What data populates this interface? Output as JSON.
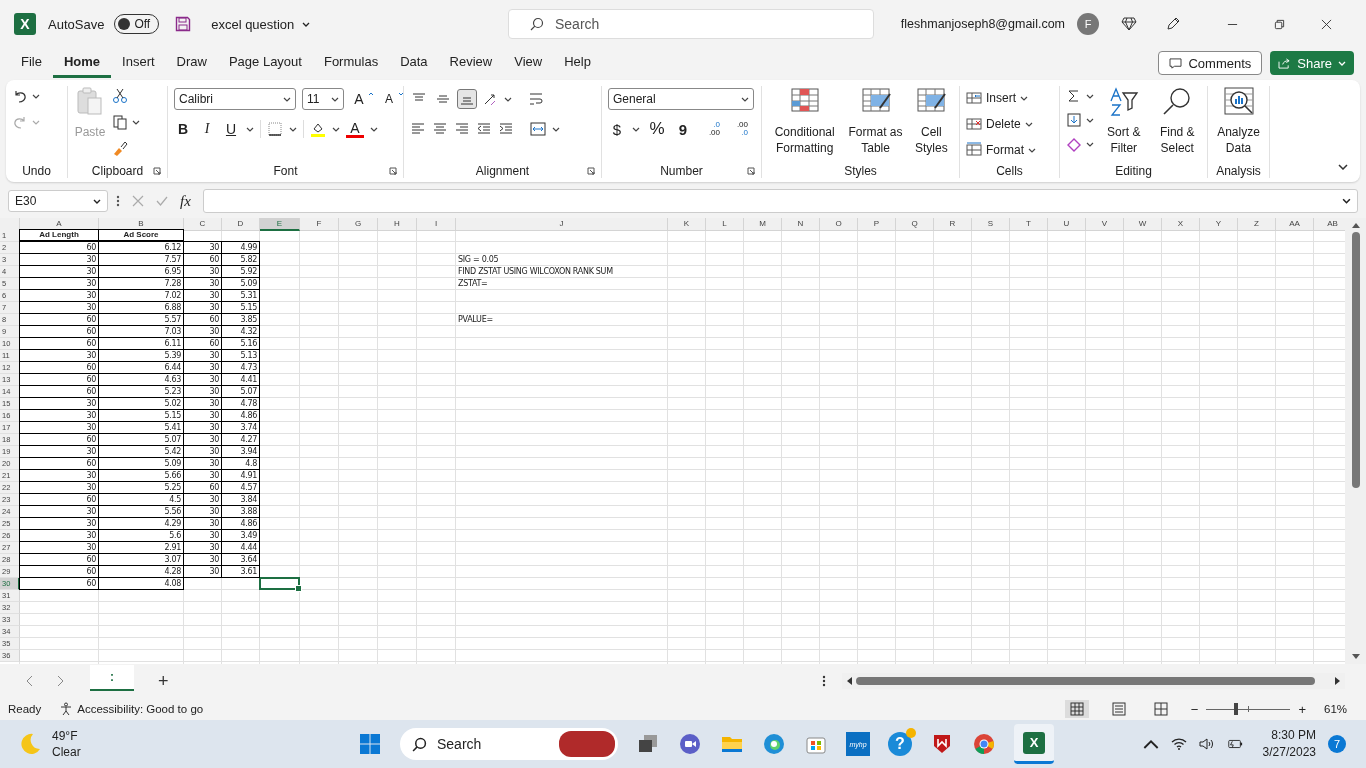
{
  "title_bar": {
    "logo": "X",
    "autosave": {
      "label": "AutoSave",
      "state": "Off",
      "on": false
    },
    "document": "excel question",
    "search": {
      "placeholder": "Search"
    },
    "account": "fleshmanjoseph8@gmail.com",
    "avatar": "F"
  },
  "menu": {
    "tabs": [
      {
        "label": "File",
        "selected": false
      },
      {
        "label": "Home",
        "selected": true
      },
      {
        "label": "Insert",
        "selected": false
      },
      {
        "label": "Draw",
        "selected": false
      },
      {
        "label": "Page Layout",
        "selected": false
      },
      {
        "label": "Formulas",
        "selected": false
      },
      {
        "label": "Data",
        "selected": false
      },
      {
        "label": "Review",
        "selected": false
      },
      {
        "label": "View",
        "selected": false
      },
      {
        "label": "Help",
        "selected": false
      }
    ],
    "comments": "Comments",
    "share": "Share"
  },
  "ribbon": {
    "groups": [
      {
        "kind": "undo",
        "label": "Undo",
        "redo_disabled": true
      },
      {
        "kind": "clipboard",
        "label": "Clipboard",
        "paste": "Paste",
        "paste_disabled": true
      },
      {
        "kind": "font",
        "label": "Font",
        "family": "Calibri",
        "size": "11",
        "grow": "A",
        "shrink": "A",
        "bold": "B",
        "italic": "I",
        "underline": "U",
        "font_color_letter": "A"
      },
      {
        "kind": "alignment",
        "label": "Alignment",
        "vertical": [
          {
            "selected": false
          },
          {
            "selected": false
          },
          {
            "selected": true
          }
        ]
      },
      {
        "kind": "number",
        "label": "Number",
        "format": "General",
        "currency": "$",
        "percent": "%",
        "comma": "9",
        "increase_decimal": [
          ".0",
          ".00"
        ],
        "decrease_decimal": [
          ".00",
          ".0"
        ]
      },
      {
        "kind": "styles",
        "label": "Styles",
        "buttons": [
          "Conditional Formatting",
          "Format as Table",
          "Cell Styles"
        ]
      },
      {
        "kind": "cells",
        "label": "Cells",
        "buttons": [
          "Insert",
          "Delete",
          "Format"
        ]
      },
      {
        "kind": "editing",
        "label": "Editing",
        "buttons": [
          "Sort & Filter",
          "Find & Select"
        ]
      },
      {
        "kind": "analysis",
        "label": "Analysis",
        "buttons": [
          "Analyze Data"
        ]
      }
    ]
  },
  "formula_bar": {
    "name_box": "E30",
    "fx": "fx"
  },
  "sheet": {
    "columns": [
      {
        "label": "A",
        "selected": false
      },
      {
        "label": "B",
        "selected": false
      },
      {
        "label": "C",
        "selected": false
      },
      {
        "label": "D",
        "selected": false
      },
      {
        "label": "E",
        "selected": true
      },
      {
        "label": "F",
        "selected": false
      },
      {
        "label": "G",
        "selected": false
      },
      {
        "label": "H",
        "selected": false
      },
      {
        "label": "I",
        "selected": false
      },
      {
        "label": "J",
        "selected": false
      },
      {
        "label": "K",
        "selected": false
      },
      {
        "label": "L",
        "selected": false
      },
      {
        "label": "M",
        "selected": false
      },
      {
        "label": "N",
        "selected": false
      },
      {
        "label": "O",
        "selected": false
      },
      {
        "label": "P",
        "selected": false
      },
      {
        "label": "Q",
        "selected": false
      },
      {
        "label": "R",
        "selected": false
      },
      {
        "label": "S",
        "selected": false
      },
      {
        "label": "T",
        "selected": false
      },
      {
        "label": "U",
        "selected": false
      },
      {
        "label": "V",
        "selected": false
      },
      {
        "label": "W",
        "selected": false
      },
      {
        "label": "X",
        "selected": false
      },
      {
        "label": "Y",
        "selected": false
      },
      {
        "label": "Z",
        "selected": false
      },
      {
        "label": "AA",
        "selected": false
      },
      {
        "label": "AB",
        "selected": false
      }
    ],
    "header_row": {
      "number": "1",
      "cells": [
        "Ad Length",
        "Ad Score"
      ],
      "selected": false
    },
    "rows": [
      {
        "number": "2",
        "cells": [
          "60",
          "6.12",
          "30",
          "4.99"
        ],
        "selected": false
      },
      {
        "number": "3",
        "cells": [
          "30",
          "7.57",
          "60",
          "5.82"
        ],
        "note": "SIG = 0.05",
        "selected": false
      },
      {
        "number": "4",
        "cells": [
          "30",
          "6.95",
          "30",
          "5.92"
        ],
        "note": "FIND ZSTAT USING WILCOXON RANK SUM",
        "selected": false
      },
      {
        "number": "5",
        "cells": [
          "30",
          "7.28",
          "30",
          "5.09"
        ],
        "note": "ZSTAT=",
        "selected": false
      },
      {
        "number": "6",
        "cells": [
          "30",
          "7.02",
          "30",
          "5.31"
        ],
        "selected": false
      },
      {
        "number": "7",
        "cells": [
          "30",
          "6.88",
          "30",
          "5.15"
        ],
        "selected": false
      },
      {
        "number": "8",
        "cells": [
          "60",
          "5.57",
          "60",
          "3.85"
        ],
        "note": "PVALUE=",
        "selected": false
      },
      {
        "number": "9",
        "cells": [
          "60",
          "7.03",
          "30",
          "4.32"
        ],
        "selected": false
      },
      {
        "number": "10",
        "cells": [
          "60",
          "6.11",
          "60",
          "5.16"
        ],
        "selected": false
      },
      {
        "number": "11",
        "cells": [
          "30",
          "5.39",
          "30",
          "5.13"
        ],
        "selected": false
      },
      {
        "number": "12",
        "cells": [
          "60",
          "6.44",
          "30",
          "4.73"
        ],
        "selected": false
      },
      {
        "number": "13",
        "cells": [
          "60",
          "4.63",
          "30",
          "4.41"
        ],
        "selected": false
      },
      {
        "number": "14",
        "cells": [
          "60",
          "5.23",
          "30",
          "5.07"
        ],
        "selected": false
      },
      {
        "number": "15",
        "cells": [
          "30",
          "5.02",
          "30",
          "4.78"
        ],
        "selected": false
      },
      {
        "number": "16",
        "cells": [
          "30",
          "5.15",
          "30",
          "4.86"
        ],
        "selected": false
      },
      {
        "number": "17",
        "cells": [
          "30",
          "5.41",
          "30",
          "3.74"
        ],
        "selected": false
      },
      {
        "number": "18",
        "cells": [
          "60",
          "5.07",
          "30",
          "4.27"
        ],
        "selected": false
      },
      {
        "number": "19",
        "cells": [
          "30",
          "5.42",
          "30",
          "3.94"
        ],
        "selected": false
      },
      {
        "number": "20",
        "cells": [
          "60",
          "5.09",
          "30",
          "4.8"
        ],
        "selected": false
      },
      {
        "number": "21",
        "cells": [
          "30",
          "5.66",
          "30",
          "4.91"
        ],
        "selected": false
      },
      {
        "number": "22",
        "cells": [
          "30",
          "5.25",
          "60",
          "4.57"
        ],
        "selected": false
      },
      {
        "number": "23",
        "cells": [
          "60",
          "4.5",
          "30",
          "3.84"
        ],
        "selected": false
      },
      {
        "number": "24",
        "cells": [
          "30",
          "5.56",
          "30",
          "3.88"
        ],
        "selected": false
      },
      {
        "number": "25",
        "cells": [
          "30",
          "4.29",
          "30",
          "4.86"
        ],
        "selected": false
      },
      {
        "number": "26",
        "cells": [
          "30",
          "5.6",
          "30",
          "3.49"
        ],
        "selected": false
      },
      {
        "number": "27",
        "cells": [
          "30",
          "2.91",
          "30",
          "4.44"
        ],
        "selected": false
      },
      {
        "number": "28",
        "cells": [
          "60",
          "3.07",
          "30",
          "3.64"
        ],
        "selected": false
      },
      {
        "number": "29",
        "cells": [
          "60",
          "4.28",
          "30",
          "3.61"
        ],
        "selected": false
      },
      {
        "number": "30",
        "cells": [
          "60",
          "4.08"
        ],
        "selected": true
      },
      {
        "number": "31",
        "selected": false
      },
      {
        "number": "32",
        "selected": false
      },
      {
        "number": "33",
        "selected": false
      },
      {
        "number": "34",
        "selected": false
      },
      {
        "number": "35",
        "selected": false
      },
      {
        "number": "36",
        "selected": false
      }
    ]
  },
  "sheet_bar": {
    "tabs": [
      {
        "label": ":",
        "selected": true
      }
    ],
    "add": "+"
  },
  "status_bar": {
    "mode": "Ready",
    "accessibility": "Accessibility: Good to go",
    "views": [
      {
        "selected": true
      },
      {
        "selected": false
      },
      {
        "selected": false
      }
    ],
    "zoom": {
      "minus": "−",
      "plus": "+",
      "level": 0.35,
      "percent": "61%"
    }
  },
  "taskbar": {
    "weather": {
      "temp": "49°F",
      "condition": "Clear"
    },
    "search": "Search",
    "hp_label": "myhp",
    "help": "?",
    "excel_letter": "X",
    "time": "8:30 PM",
    "date": "3/27/2023",
    "notifications": "7"
  }
}
